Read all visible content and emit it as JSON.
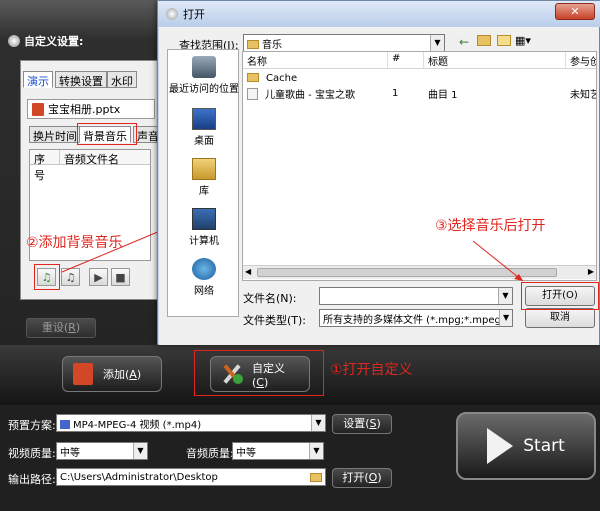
{
  "app": {
    "title": "自定义设置:",
    "tabs": [
      "演示",
      "转换设置",
      "水印"
    ],
    "file_name": "宝宝相册.pptx",
    "subtabs": [
      "换片时间",
      "背景音乐",
      "声音"
    ],
    "list_columns": [
      "序号",
      "音频文件名"
    ],
    "reset_label": "重设(",
    "reset_key": "R",
    "add_label": "添加(",
    "add_key": "A",
    "custom_label": "自定义(",
    "custom_key": "C",
    "preset_label": "预置方案:",
    "preset_value": "MP4-MPEG-4 视频 (*.mp4)",
    "settings_label": "设置(",
    "settings_key": "S",
    "video_quality_label": "视频质量:",
    "video_quality_value": "中等",
    "audio_quality_label": "音频质量:",
    "audio_quality_value": "中等",
    "output_label": "输出路径:",
    "output_path": "C:\\Users\\Administrator\\Desktop",
    "open_label": "打开(",
    "open_key": "O",
    "start_label": "Start"
  },
  "annotations": {
    "step1": "①打开自定义",
    "step2": "②添加背景音乐",
    "step3": "③选择音乐后打开"
  },
  "dialog": {
    "title": "打开",
    "lookin_label": "查找范围(I):",
    "lookin_value": "音乐",
    "places": [
      "最近访问的位置",
      "桌面",
      "库",
      "计算机",
      "网络"
    ],
    "columns": [
      "名称",
      "#",
      "标题",
      "参与创"
    ],
    "files": [
      {
        "name": "Cache",
        "num": "",
        "title": "",
        "artist": ""
      },
      {
        "name": "儿童歌曲 - 宝宝之歌",
        "num": "1",
        "title": "曲目 1",
        "artist": "未知艺"
      }
    ],
    "filename_label": "文件名(N):",
    "filename_value": "",
    "filetype_label": "文件类型(T):",
    "filetype_value": "所有支持的多媒体文件 (*.mpg;*.mpeg;*.v",
    "open_button": "打开(O)",
    "cancel_button": "取消"
  }
}
